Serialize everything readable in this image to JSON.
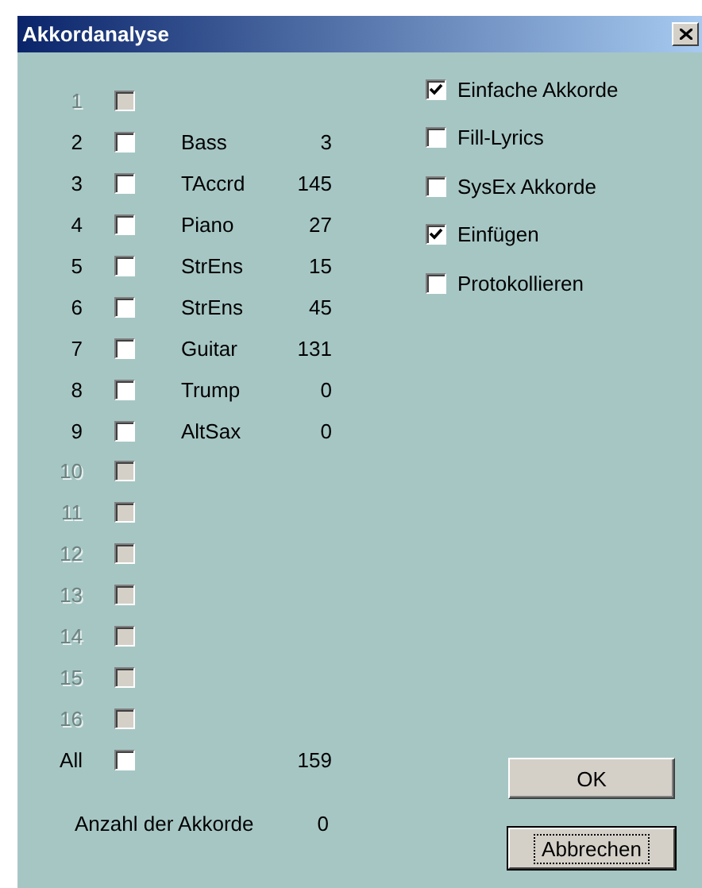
{
  "window": {
    "title": "Akkordanalyse"
  },
  "tracks": [
    {
      "number": "1",
      "disabled": true,
      "checked": false
    },
    {
      "number": "2",
      "disabled": false,
      "checked": false,
      "instrument": "Bass",
      "count": "3"
    },
    {
      "number": "3",
      "disabled": false,
      "checked": false,
      "instrument": "TAccrd",
      "count": "145"
    },
    {
      "number": "4",
      "disabled": false,
      "checked": false,
      "instrument": "Piano",
      "count": "27"
    },
    {
      "number": "5",
      "disabled": false,
      "checked": false,
      "instrument": "StrEns",
      "count": "15"
    },
    {
      "number": "6",
      "disabled": false,
      "checked": false,
      "instrument": "StrEns",
      "count": "45"
    },
    {
      "number": "7",
      "disabled": false,
      "checked": false,
      "instrument": "Guitar",
      "count": "131"
    },
    {
      "number": "8",
      "disabled": false,
      "checked": false,
      "instrument": "Trump",
      "count": "0"
    },
    {
      "number": "9",
      "disabled": false,
      "checked": false,
      "instrument": "AltSax",
      "count": "0"
    },
    {
      "number": "10",
      "disabled": true,
      "checked": false
    },
    {
      "number": "11",
      "disabled": true,
      "checked": false
    },
    {
      "number": "12",
      "disabled": true,
      "checked": false
    },
    {
      "number": "13",
      "disabled": true,
      "checked": false
    },
    {
      "number": "14",
      "disabled": true,
      "checked": false
    },
    {
      "number": "15",
      "disabled": true,
      "checked": false
    },
    {
      "number": "16",
      "disabled": true,
      "checked": false
    }
  ],
  "all": {
    "label": "All",
    "checked": false,
    "count": "159"
  },
  "chord_count": {
    "label": "Anzahl der Akkorde",
    "value": "0"
  },
  "options": [
    {
      "label": "Einfache Akkorde",
      "checked": true
    },
    {
      "label": "Fill-Lyrics",
      "checked": false
    },
    {
      "label": "SysEx Akkorde",
      "checked": false
    },
    {
      "label": "Einfügen",
      "checked": true
    },
    {
      "label": "Protokollieren",
      "checked": false
    }
  ],
  "buttons": [
    {
      "label": "OK",
      "focused": false
    },
    {
      "label": "Abbrechen",
      "focused": true
    }
  ]
}
